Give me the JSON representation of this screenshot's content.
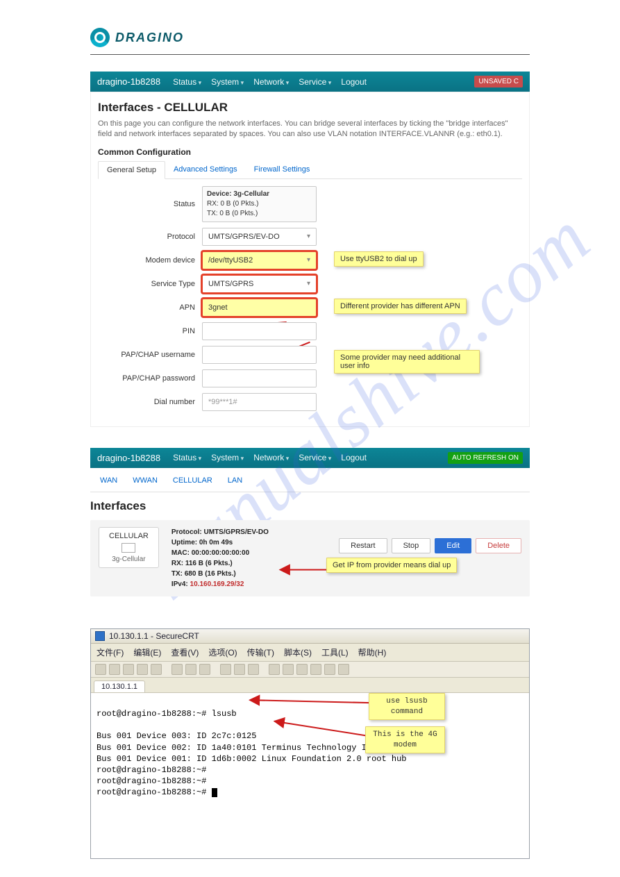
{
  "logo_text": "DRAGINO",
  "watermark": "manualshive.com",
  "bar1": {
    "host": "dragino-1b8288",
    "menu": [
      "Status",
      "System",
      "Network",
      "Service"
    ],
    "logout": "Logout",
    "badge": "UNSAVED C"
  },
  "panel1": {
    "title": "Interfaces - CELLULAR",
    "hint": "On this page you can configure the network interfaces. You can bridge several interfaces by ticking the \"bridge interfaces\" field and network interfaces separated by spaces. You can also use VLAN notation INTERFACE.VLANNR (e.g.: eth0.1).",
    "subhead": "Common Configuration",
    "tabs": [
      "General Setup",
      "Advanced Settings",
      "Firewall Settings"
    ],
    "status_label": "Status",
    "status": {
      "device": "Device: 3g-Cellular",
      "rx": "RX: 0 B (0 Pkts.)",
      "tx": "TX: 0 B (0 Pkts.)"
    },
    "protocol_label": "Protocol",
    "protocol": "UMTS/GPRS/EV-DO",
    "modem_label": "Modem device",
    "modem": "/dev/ttyUSB2",
    "svc_label": "Service Type",
    "svc": "UMTS/GPRS",
    "apn_label": "APN",
    "apn": "3gnet",
    "pin_label": "PIN",
    "user_label": "PAP/CHAP username",
    "pass_label": "PAP/CHAP password",
    "dial_label": "Dial number",
    "dial": "*99***1#",
    "callouts": {
      "modem": "Use  ttyUSB2 to dial up",
      "apn": "Different  provider has different APN",
      "cred": "Some provider may need additional user info"
    }
  },
  "bar2": {
    "host": "dragino-1b8288",
    "menu": [
      "Status",
      "System",
      "Network",
      "Service"
    ],
    "logout": "Logout",
    "refresh": "AUTO REFRESH ON"
  },
  "subnav": [
    "WAN",
    "WWAN",
    "CELLULAR",
    "LAN"
  ],
  "panel2": {
    "title": "Interfaces",
    "iface_name": "CELLULAR",
    "iface_sub": "3g-Cellular",
    "stats": {
      "protocol": "Protocol: UMTS/GPRS/EV-DO",
      "uptime": "Uptime: 0h 0m 49s",
      "mac": "MAC: 00:00:00:00:00:00",
      "rx": "RX: 116 B (6 Pkts.)",
      "tx": "TX: 680 B (16 Pkts.)",
      "ipv4_label": "IPv4:",
      "ipv4": "10.160.169.29/32"
    },
    "btns": {
      "restart": "Restart",
      "stop": "Stop",
      "edit": "Edit",
      "delete": "Delete"
    },
    "callout": "Get IP from provider means dial up"
  },
  "crt": {
    "title": "10.130.1.1 - SecureCRT",
    "menu": [
      "文件(F)",
      "编辑(E)",
      "查看(V)",
      "选项(O)",
      "传输(T)",
      "脚本(S)",
      "工具(L)",
      "帮助(H)"
    ],
    "tab": "10.130.1.1",
    "lines": [
      "root@dragino-1b8288:~# lsusb",
      "",
      "Bus 001 Device 003: ID 2c7c:0125",
      "Bus 001 Device 002: ID 1a40:0101 Terminus Technology Inc. Hub",
      "Bus 001 Device 001: ID 1d6b:0002 Linux Foundation 2.0 root hub",
      "root@dragino-1b8288:~#",
      "root@dragino-1b8288:~#",
      "root@dragino-1b8288:~# "
    ],
    "callouts": {
      "cmd": "use lsusb command",
      "modem": "This is the 4G modem"
    }
  }
}
